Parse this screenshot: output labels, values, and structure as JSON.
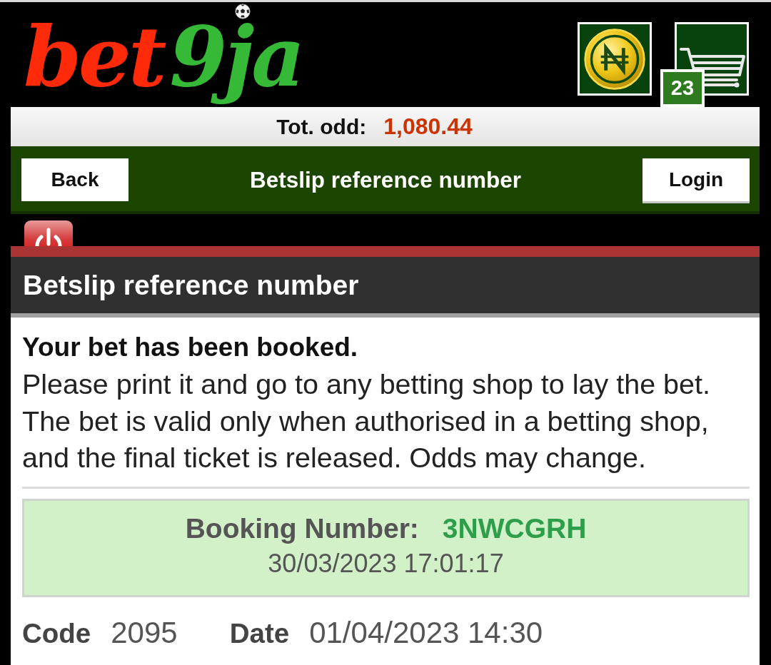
{
  "header": {
    "logo": [
      {
        "text": "bet",
        "color": "#ff2a0a"
      },
      {
        "text": "9ja",
        "color": "#36b936"
      }
    ],
    "cart_count": "23"
  },
  "total_odds": {
    "label": "Tot. odd:",
    "value": "1,080.44"
  },
  "nav": {
    "back": "Back",
    "title": "Betslip reference number",
    "login": "Login"
  },
  "panel": {
    "title": "Betslip reference number",
    "heading": "Your bet has been booked.",
    "instructions": [
      "Please print it and go to any betting shop to lay the bet.",
      "The bet is valid only when authorised in a betting shop, and the final ticket is released. Odds may change."
    ],
    "booking": {
      "label": "Booking Number:",
      "number": "3NWCGRH",
      "timestamp": "30/03/2023 17:01:17"
    },
    "details": [
      {
        "label": "Code",
        "value": "2095"
      },
      {
        "label": "Date",
        "value": "01/04/2023 14:30"
      }
    ]
  }
}
